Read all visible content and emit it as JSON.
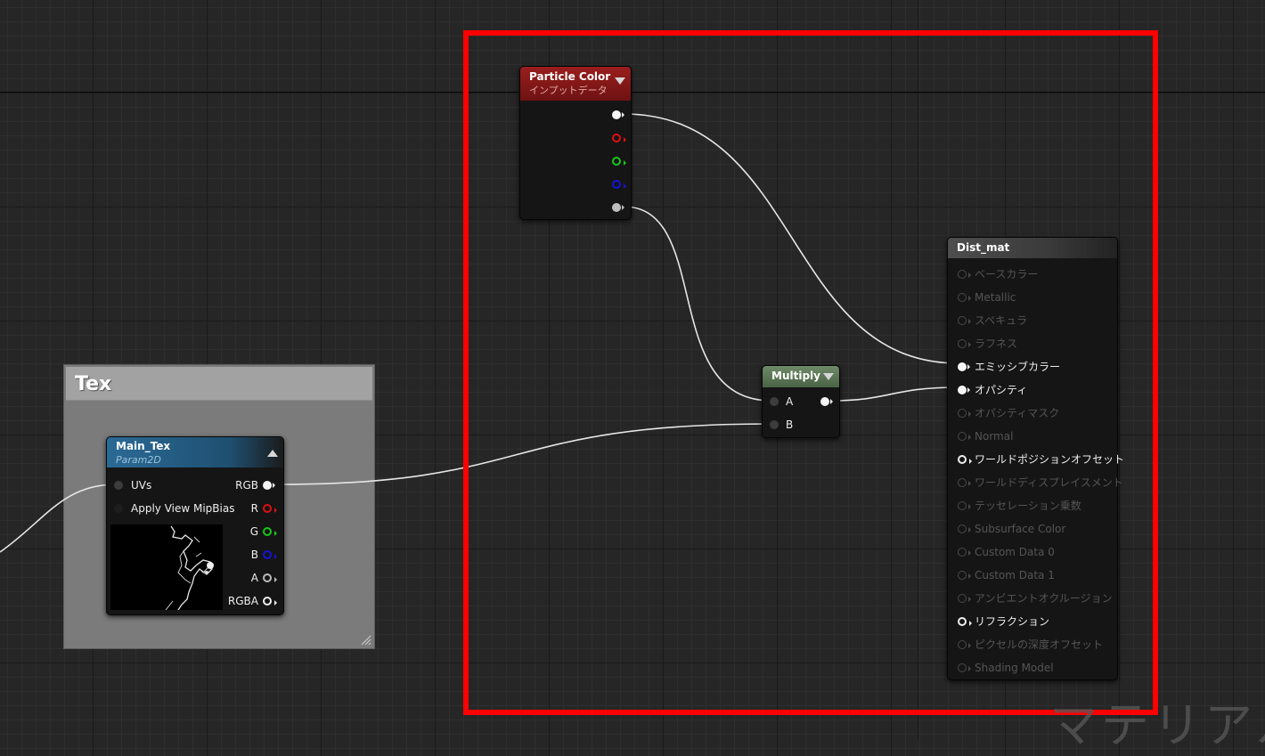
{
  "comment": {
    "title": "Tex"
  },
  "texture_node": {
    "title": "Main_Tex",
    "subtitle": "Param2D",
    "inputs": [
      "UVs",
      "Apply View MipBias"
    ],
    "outputs": [
      "RGB",
      "R",
      "G",
      "B",
      "A",
      "RGBA"
    ]
  },
  "particle_node": {
    "title": "Particle Color",
    "subtitle": "インプットデータ"
  },
  "multiply_node": {
    "title": "Multiply",
    "input_a": "A",
    "input_b": "B"
  },
  "material_node": {
    "title": "Dist_mat",
    "pins": [
      {
        "label": "ベースカラー",
        "state": "disabled"
      },
      {
        "label": "Metallic",
        "state": "disabled"
      },
      {
        "label": "スペキュラ",
        "state": "disabled"
      },
      {
        "label": "ラフネス",
        "state": "disabled"
      },
      {
        "label": "エミッシブカラー",
        "state": "connected"
      },
      {
        "label": "オパシティ",
        "state": "connected"
      },
      {
        "label": "オパシティマスク",
        "state": "disabled"
      },
      {
        "label": "Normal",
        "state": "disabled"
      },
      {
        "label": "ワールドポジションオフセット",
        "state": "enabled"
      },
      {
        "label": "ワールドディスプレイスメント",
        "state": "disabled"
      },
      {
        "label": "テッセレーション乗数",
        "state": "disabled"
      },
      {
        "label": "Subsurface Color",
        "state": "disabled"
      },
      {
        "label": "Custom Data 0",
        "state": "disabled"
      },
      {
        "label": "Custom Data 1",
        "state": "disabled"
      },
      {
        "label": "アンビエントオクルージョン",
        "state": "disabled"
      },
      {
        "label": "リフラクション",
        "state": "enabled"
      },
      {
        "label": "ピクセルの深度オフセット",
        "state": "disabled"
      },
      {
        "label": "Shading Model",
        "state": "disabled"
      }
    ]
  },
  "watermark": "マテリアル",
  "colors": {
    "selection_outline": "#ff0000",
    "particle_header": "#8a1a1a",
    "texture_header": "#2a6a96",
    "multiply_header": "#5e7a58",
    "material_header": "#454545"
  }
}
